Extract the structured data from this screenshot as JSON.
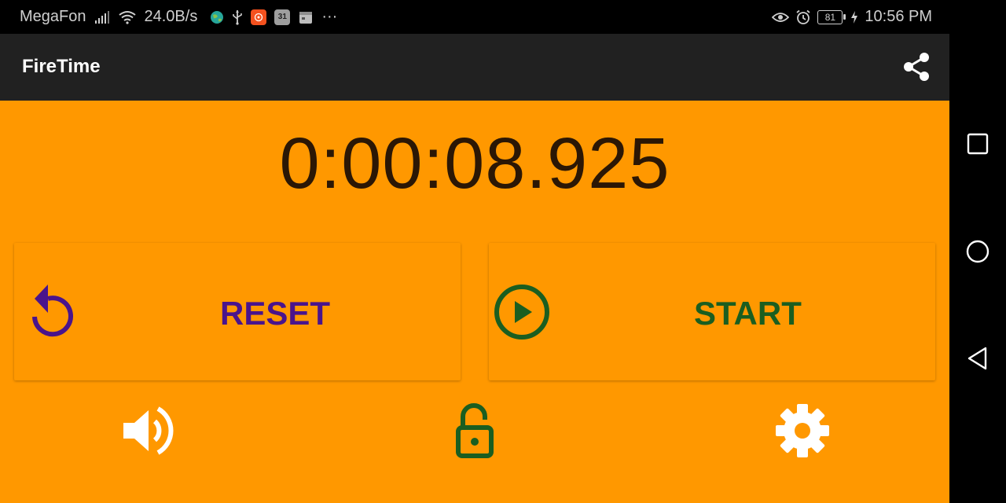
{
  "status_bar": {
    "carrier": "MegaFon",
    "network_speed": "24.0B/s",
    "calendar_day": "31",
    "more": "···",
    "battery_level": "81",
    "time": "10:56 PM",
    "icons_left": [
      "signal-icon",
      "wifi-icon",
      "globe-icon",
      "usb-icon",
      "app-notification-icon",
      "calendar-icon",
      "calendar-app-icon"
    ],
    "icons_right": [
      "eye-comfort-icon",
      "alarm-icon",
      "battery-icon",
      "charging-icon"
    ]
  },
  "app_bar": {
    "title": "FireTime",
    "share_icon": "share-icon"
  },
  "timer": {
    "display": "0:00:08.925"
  },
  "buttons": {
    "reset_label": "RESET",
    "reset_icon": "reset-icon",
    "start_label": "START",
    "start_icon": "play-circle-icon"
  },
  "bottom_controls": {
    "sound_icon": "volume-icon",
    "lock_icon": "unlock-icon",
    "settings_icon": "gear-icon"
  },
  "nav_bar": {
    "icons": [
      "recents-icon",
      "home-icon",
      "back-icon"
    ]
  },
  "colors": {
    "background": "#ff9800",
    "app_bar": "#212121",
    "timer_text": "#2b1705",
    "reset": "#4a148c",
    "start": "#1b5e20",
    "lock": "#1b5e20",
    "white_icons": "#ffffff"
  }
}
